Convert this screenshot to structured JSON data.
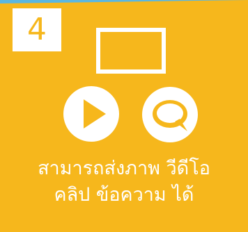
{
  "step_number": "4",
  "caption": {
    "line1": "สามารถส่งภาพ วีดีโอ",
    "line2": "คลิป ข้อความ ได้"
  },
  "icons": [
    "screen-icon",
    "play-icon",
    "chat-icon"
  ],
  "colors": {
    "card": "#f6b71c",
    "foreground": "#ffffff",
    "background_strip": "#5bb7e0"
  }
}
